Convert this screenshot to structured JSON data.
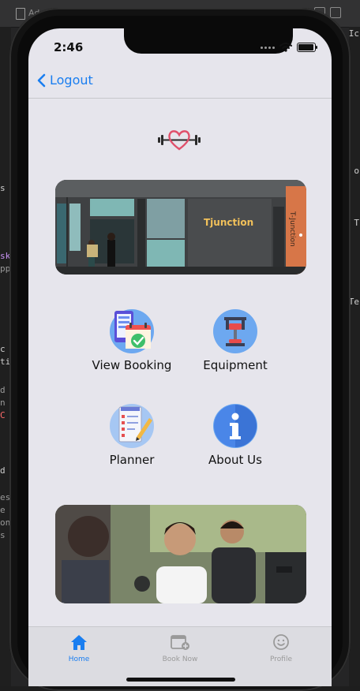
{
  "editor": {
    "tab_label": "Ad",
    "fragments": [
      "s",
      "sk",
      "pp",
      "c",
      "ti",
      "d",
      "n",
      "C",
      "d",
      "es",
      "e",
      "on",
      "s",
      "Ic",
      "o",
      "T",
      "Te"
    ]
  },
  "status": {
    "time": "2:46"
  },
  "nav": {
    "back_label": "Logout"
  },
  "menu": [
    {
      "label": "View Booking",
      "icon": "calendar-check-icon"
    },
    {
      "label": "Equipment",
      "icon": "dumbbell-machine-icon"
    },
    {
      "label": "Planner",
      "icon": "checklist-pencil-icon"
    },
    {
      "label": "About Us",
      "icon": "info-icon"
    }
  ],
  "banner": {
    "sign_text": "Tjunction",
    "side_text": "T-Junction"
  },
  "tabs": [
    {
      "label": "Home",
      "icon": "home-icon",
      "active": true
    },
    {
      "label": "Book Now",
      "icon": "calendar-plus-icon",
      "active": false
    },
    {
      "label": "Profile",
      "icon": "smiley-icon",
      "active": false
    }
  ],
  "colors": {
    "accent": "#1a7ef0",
    "logo_heart": "#e0506b",
    "tab_inactive": "#9a9a9a"
  }
}
